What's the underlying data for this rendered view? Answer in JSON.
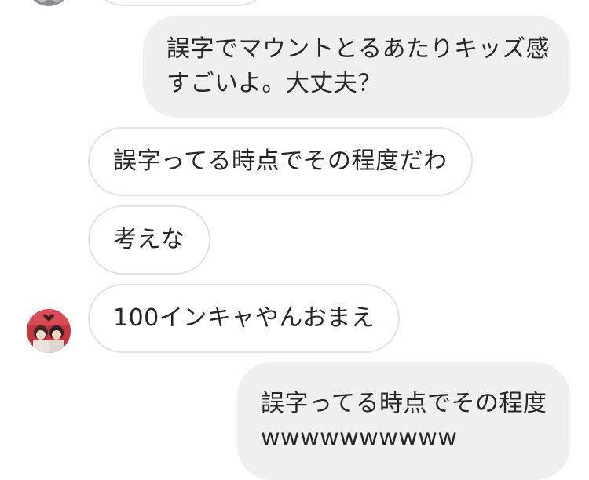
{
  "conversation": {
    "messages": [
      {
        "direction": "outgoing",
        "lines": [
          "誤字でマウントとるあたりキッズ感",
          "すごいよ。大丈夫？"
        ]
      },
      {
        "direction": "incoming",
        "lines": [
          "誤字ってる時点でその程度だわ"
        ]
      },
      {
        "direction": "incoming",
        "lines": [
          "考えな"
        ]
      },
      {
        "direction": "incoming",
        "lines": [
          "100インキャやんおまえ"
        ]
      },
      {
        "direction": "outgoing",
        "lines": [
          "誤字ってる時点でその程度",
          "wwwwwwwwww"
        ]
      }
    ]
  },
  "avatar": {
    "icon": "profile-photo-avatar"
  },
  "colors": {
    "incoming_bg": "#ffffff",
    "incoming_border": "#e3e3e3",
    "outgoing_bg": "#efefef",
    "text": "#262626"
  }
}
